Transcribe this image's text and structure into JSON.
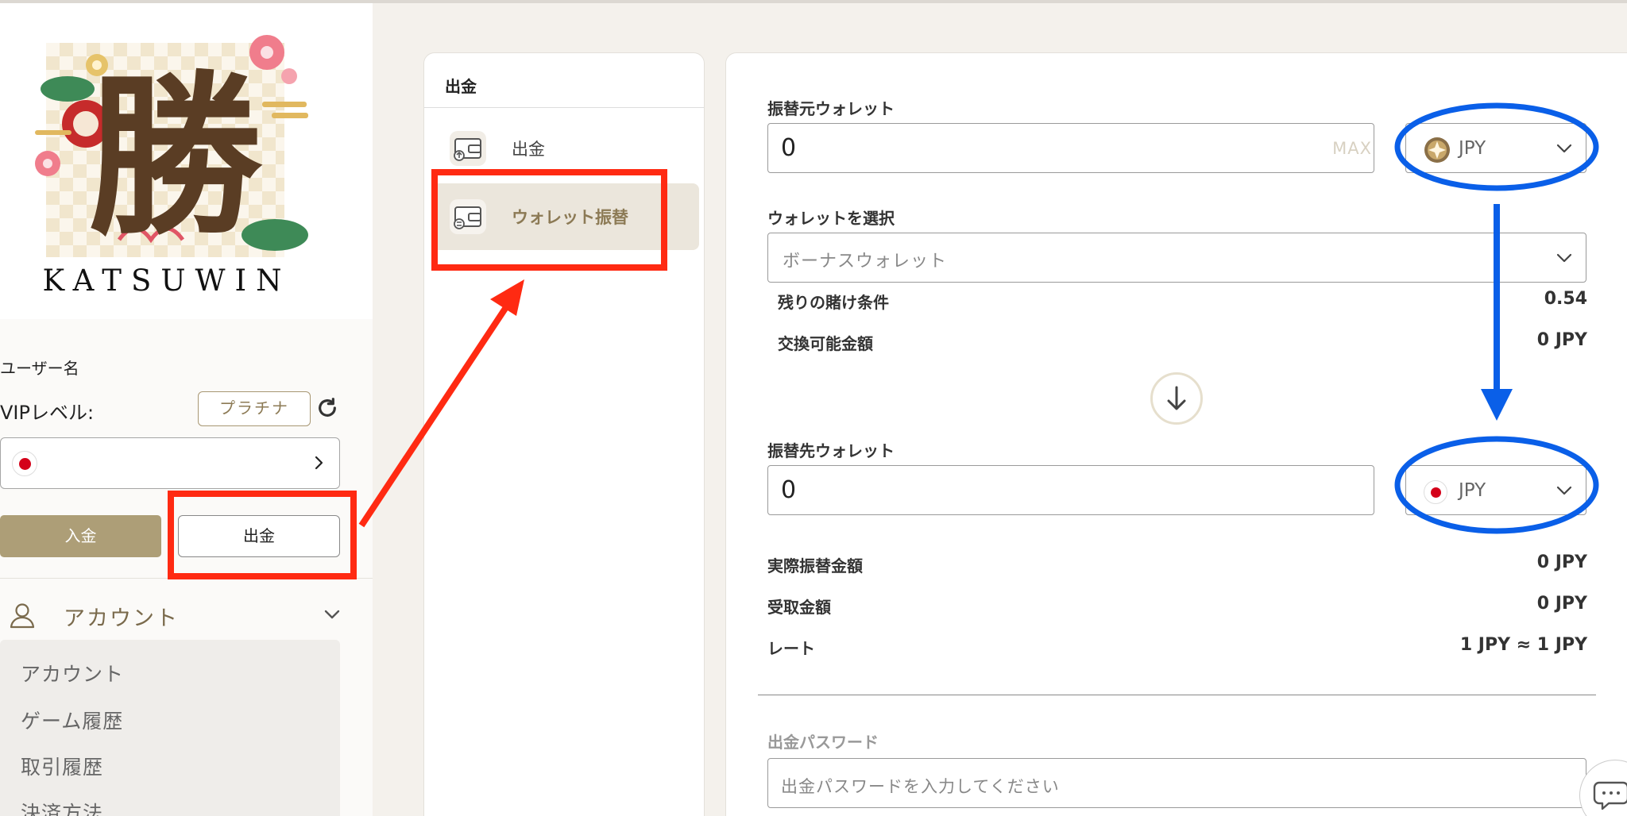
{
  "brand": {
    "logo_text": "KATSUWIN",
    "logo_kanji": "勝"
  },
  "user": {
    "username_label": "ユーザー名",
    "vip_label": "VIPレベル:",
    "vip_level": "プラチナ"
  },
  "actions": {
    "deposit_label": "入金",
    "withdraw_label": "出金"
  },
  "account_section": {
    "title": "アカウント",
    "items": [
      "アカウント",
      "ゲーム履歴",
      "取引履歴",
      "決済方法"
    ]
  },
  "withdraw_menu": {
    "title": "出金",
    "items": [
      {
        "label": "出金",
        "active": false
      },
      {
        "label": "ウォレット振替",
        "active": true
      }
    ]
  },
  "transfer": {
    "from_label": "振替元ウォレット",
    "from_amount": "0",
    "max_label": "MAX",
    "from_currency": "JPY",
    "select_wallet_label": "ウォレットを選択",
    "selected_wallet": "ボーナスウォレット",
    "remaining_wager_label": "残りの賭け条件",
    "remaining_wager_value": "0.54",
    "exchangeable_label": "交換可能金額",
    "exchangeable_value": "0 JPY",
    "to_label": "振替先ウォレット",
    "to_amount": "0",
    "to_currency": "JPY",
    "actual_amount_label": "実際振替金額",
    "actual_amount_value": "0 JPY",
    "received_label": "受取金額",
    "received_value": "0 JPY",
    "rate_label": "レート",
    "rate_value": "1 JPY ≈ 1 JPY",
    "password_label": "出金パスワード",
    "password_placeholder": "出金パスワードを入力してください"
  },
  "colors": {
    "accent_gold": "#ad9e77",
    "highlight_red": "#ff2a12",
    "highlight_blue": "#0a5fe8",
    "active_bg": "#ebe6dc"
  }
}
